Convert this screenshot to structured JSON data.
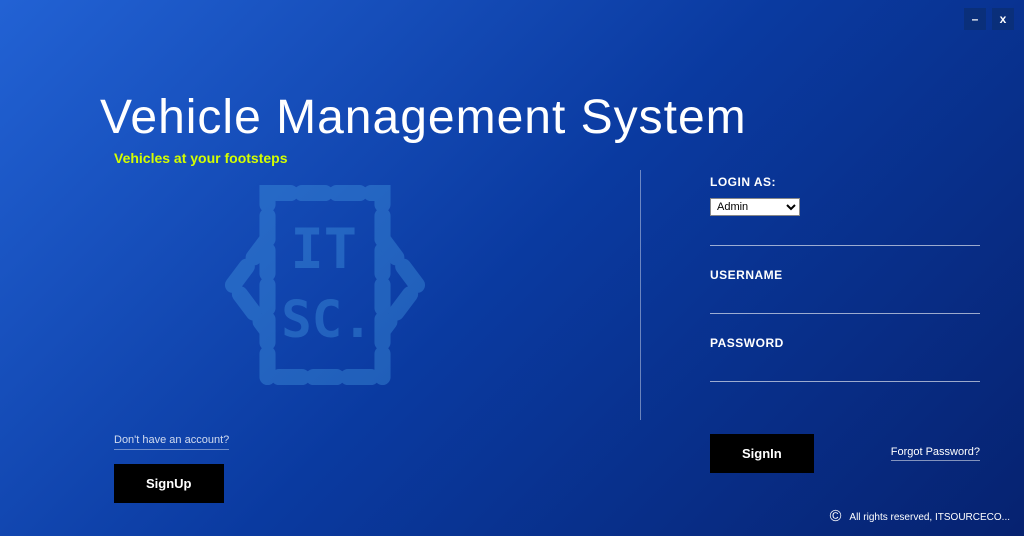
{
  "window": {
    "minimize": "–",
    "close": "x"
  },
  "header": {
    "title": "Vehicle Management System",
    "subtitle": "Vehicles at your footsteps"
  },
  "login": {
    "login_as_label": "LOGIN AS:",
    "role_selected": "Admin",
    "username_label": "USERNAME",
    "username_value": "",
    "password_label": "PASSWORD",
    "password_value": "",
    "signin_label": "SignIn",
    "forgot_label": "Forgot Password?"
  },
  "signup": {
    "prompt": "Don't have an account?",
    "button_label": "SignUp"
  },
  "footer": {
    "copyright_symbol": "©",
    "text": "All rights reserved, ITSOURCECO..."
  }
}
